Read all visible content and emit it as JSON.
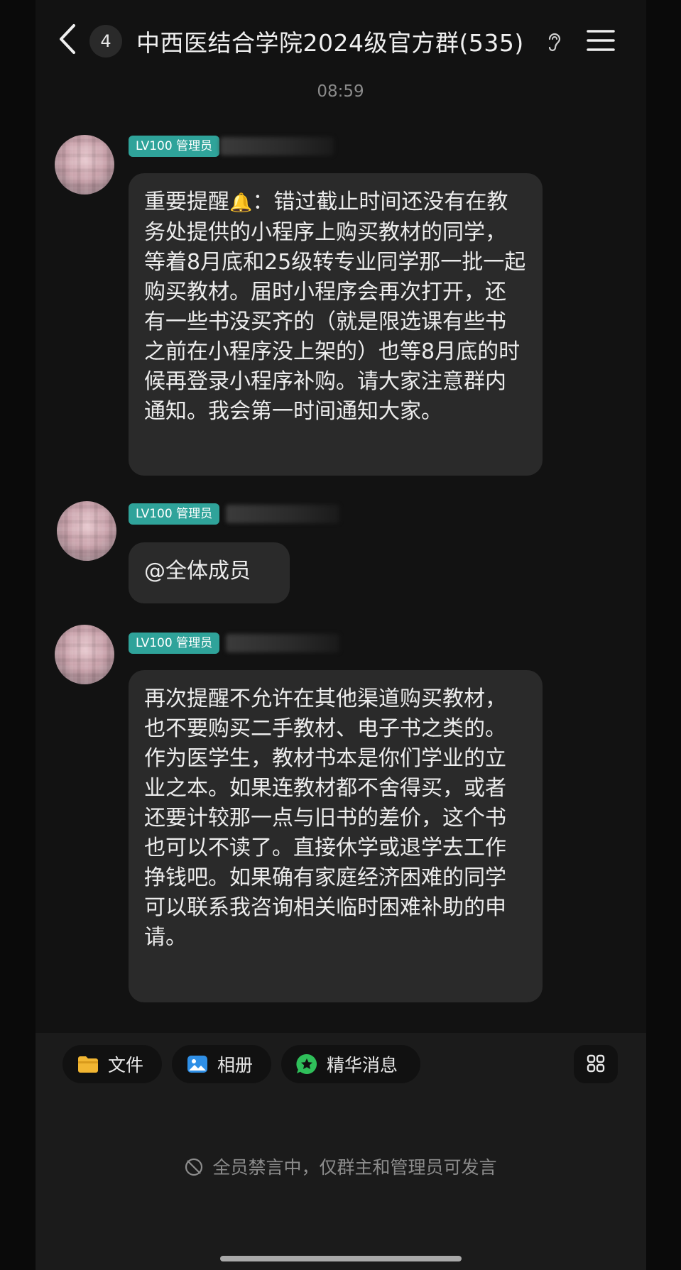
{
  "header": {
    "unread_count": "4",
    "title": "中西医结合学院2024级官方群(535)"
  },
  "timestamp": "08:59",
  "messages": [
    {
      "badge": "LV100 管理员",
      "text_before_icon": "重要提醒",
      "icon": "bell-icon",
      "text": "：错过截止时间还没有在教务处提供的小程序上购买教材的同学，等着8月底和25级转专业同学那一批一起购买教材。届时小程序会再次打开，还有一些书没买齐的（就是限选课有些书之前在小程序没上架的）也等8月底的时候再登录小程序补购。请大家注意群内通知。我会第一时间通知大家。"
    },
    {
      "badge": "LV100 管理员",
      "text": "@全体成员"
    },
    {
      "badge": "LV100 管理员",
      "text": "再次提醒不允许在其他渠道购买教材，也不要购买二手教材、电子书之类的。作为医学生，教材书本是你们学业的立业之本。如果连教材都不舍得买，或者还要计较那一点与旧书的差价，这个书也可以不读了。直接休学或退学去工作挣钱吧。如果确有家庭经济困难的同学可以联系我咨询相关临时困难补助的申请。"
    }
  ],
  "toolbar": {
    "files_label": "文件",
    "album_label": "相册",
    "highlights_label": "精华消息",
    "more_icon": "grid-more-icon"
  },
  "muted_notice": "全员禁言中，仅群主和管理员可发言",
  "colors": {
    "background": "#121212",
    "bubble": "#2a2a2a",
    "admin_badge": "#2fa39a",
    "folder_icon": "#f2b632",
    "album_icon": "#2f8fe6",
    "highlights_icon": "#2fbf5a"
  }
}
